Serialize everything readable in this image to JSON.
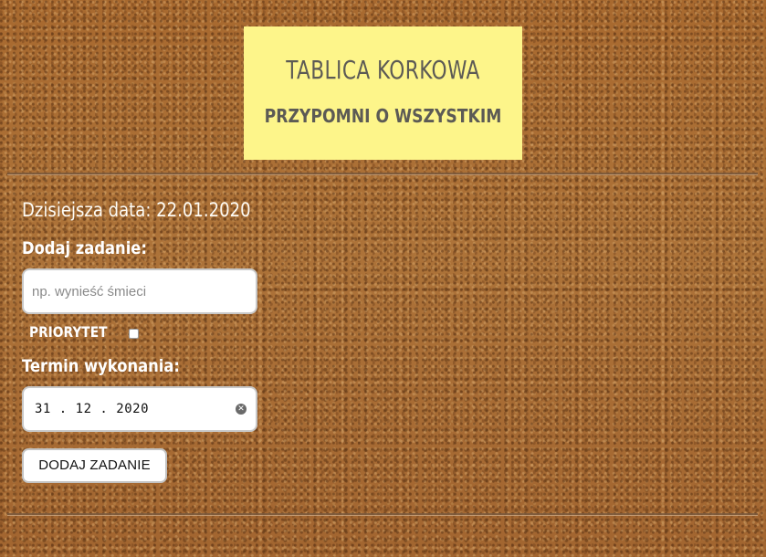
{
  "header": {
    "title": "TABLICA KORKOWA",
    "subtitle": "PRZYPOMNI O WSZYSTKIM"
  },
  "date_info": {
    "text": "Dzisiejsza data: 22.01.2020"
  },
  "form": {
    "add_task_label": "Dodaj zadanie:",
    "task_input": {
      "value": "",
      "placeholder": "np. wynieść śmieci"
    },
    "priority_label": "PRIORYTET",
    "priority_checked": false,
    "deadline_label": "Termin wykonania:",
    "deadline_value": "31 . 12 . 2020",
    "submit_label": "DODAJ ZADANIE"
  },
  "icons": {
    "clear": "clear-icon"
  },
  "colors": {
    "background": "#a86c36",
    "header_card": "#fdf58a",
    "header_text": "#5c5a55",
    "form_text": "#ffffff"
  }
}
